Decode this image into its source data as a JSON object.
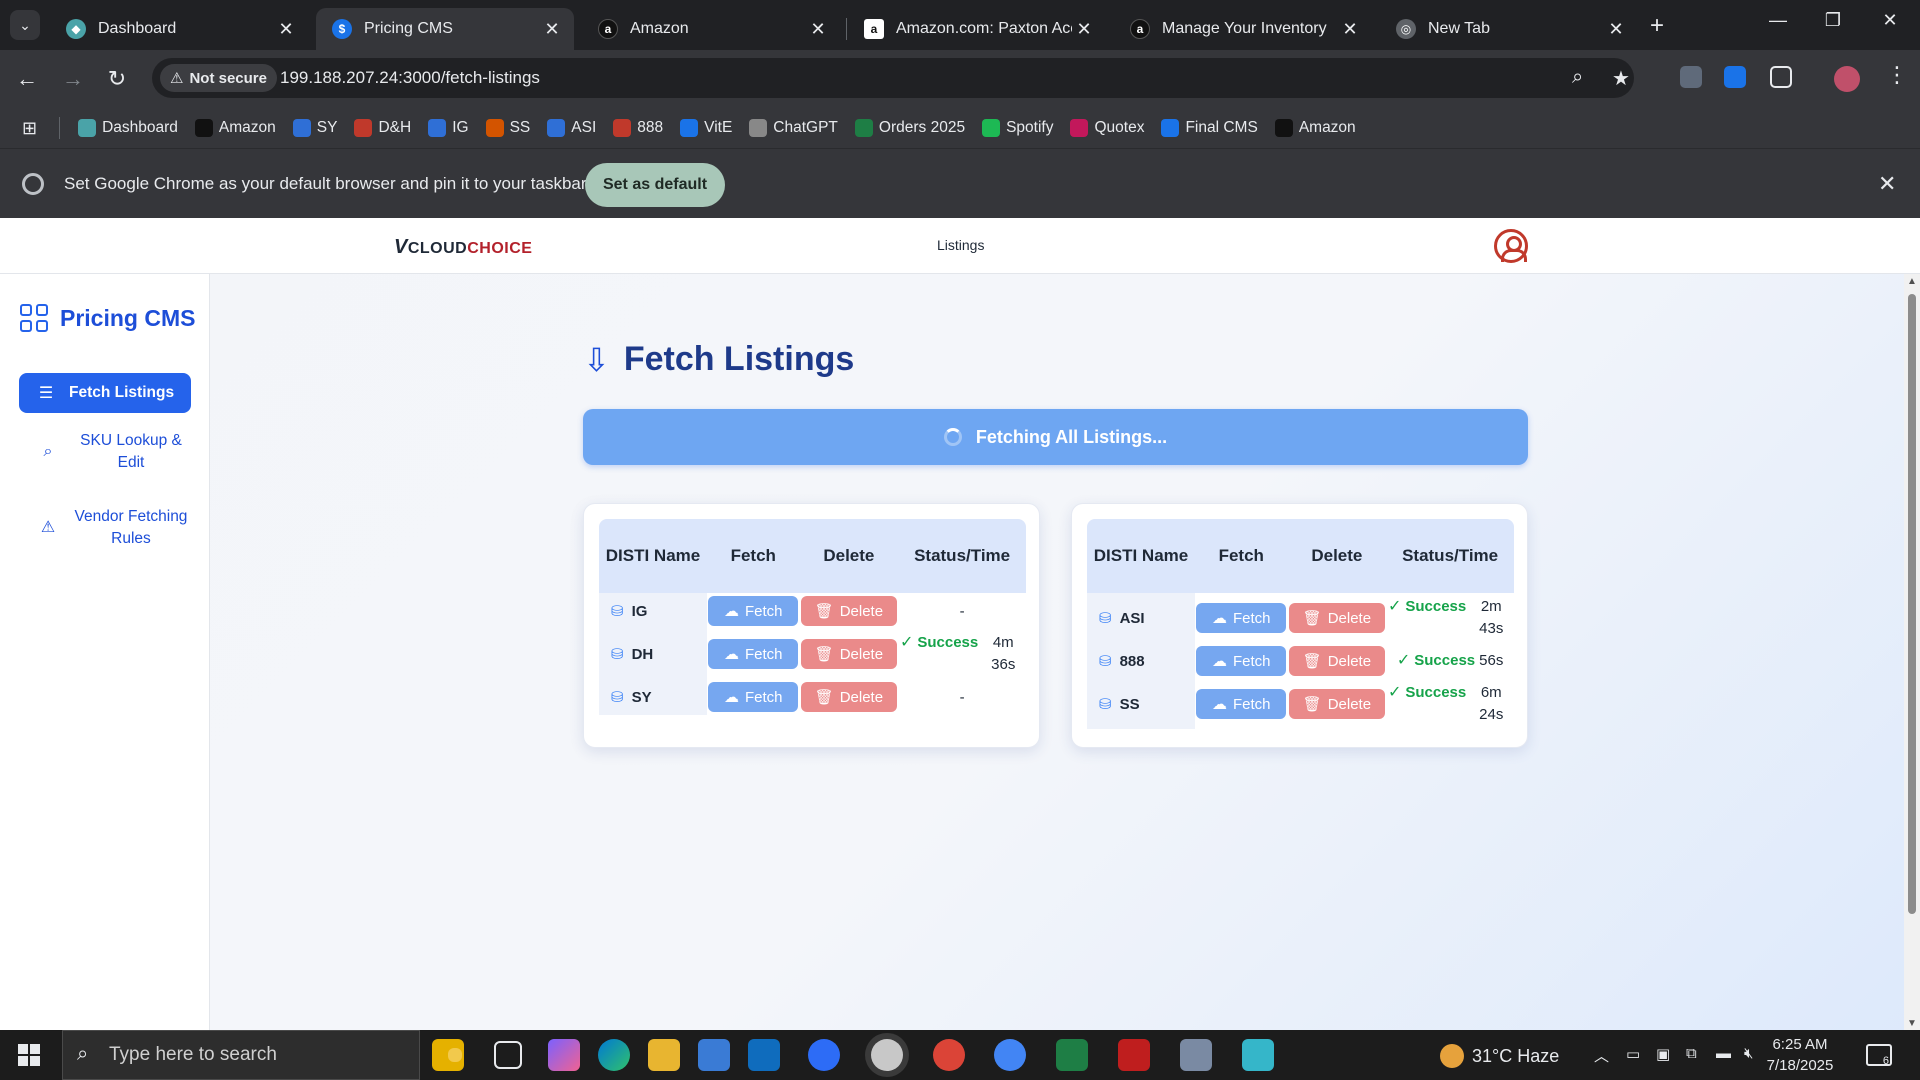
{
  "browser": {
    "tabs": [
      {
        "title": "Dashboard",
        "icon": "dashboard-favicon",
        "active": false
      },
      {
        "title": "Pricing CMS",
        "icon": "dollar-favicon",
        "active": true
      },
      {
        "title": "Amazon",
        "icon": "amazon-favicon",
        "active": false
      },
      {
        "title": "Amazon.com: Paxton Acce",
        "icon": "amazon-favicon",
        "active": false
      },
      {
        "title": "Manage Your Inventory",
        "icon": "amazon-favicon",
        "active": false
      },
      {
        "title": "New Tab",
        "icon": "chrome-favicon",
        "active": false
      }
    ],
    "security_label": "Not secure",
    "url": "199.188.207.24:3000/fetch-listings",
    "bookmarks": [
      {
        "label": "Dashboard",
        "icon": "dashboard-icon",
        "color": "#4aa3a8"
      },
      {
        "label": "Amazon",
        "icon": "amazon-icon",
        "color": "#111111"
      },
      {
        "label": "SY",
        "icon": "ec-icon",
        "color": "#2f6fd6"
      },
      {
        "label": "D&H",
        "icon": "dh-icon",
        "color": "#c0392b"
      },
      {
        "label": "IG",
        "icon": "ig-icon",
        "color": "#2f6fd6"
      },
      {
        "label": "SS",
        "icon": "ss-icon",
        "color": "#d35400"
      },
      {
        "label": "ASI",
        "icon": "asi-icon",
        "color": "#2f6fd6"
      },
      {
        "label": "888",
        "icon": "888-icon",
        "color": "#c0392b"
      },
      {
        "label": "VitE",
        "icon": "dollar-icon",
        "color": "#1a73e8"
      },
      {
        "label": "ChatGPT",
        "icon": "chatgpt-icon",
        "color": "#888888"
      },
      {
        "label": "Orders 2025",
        "icon": "excel-icon",
        "color": "#1e7e45"
      },
      {
        "label": "Spotify",
        "icon": "spotify-icon",
        "color": "#1db954"
      },
      {
        "label": "Quotex",
        "icon": "quotex-icon",
        "color": "#c2185b"
      },
      {
        "label": "Final CMS",
        "icon": "dollar-icon",
        "color": "#1a73e8"
      },
      {
        "label": "Amazon",
        "icon": "amazon-icon",
        "color": "#111111"
      }
    ],
    "infobar_message": "Set Google Chrome as your default browser and pin it to your taskbar",
    "infobar_button": "Set as default"
  },
  "app": {
    "logo_prefix": "V",
    "logo_cloud": "CLOUD",
    "logo_choice": "CHOICE",
    "nav_link": "Listings",
    "brand": "Pricing CMS",
    "sidebar": [
      {
        "label": "Fetch Listings",
        "icon": "list-icon",
        "active": true
      },
      {
        "label": "SKU Lookup & Edit",
        "icon": "search-icon",
        "active": false
      },
      {
        "label": "Vendor Fetching Rules",
        "icon": "warning-icon",
        "active": false
      }
    ],
    "page_title": "Fetch Listings",
    "fetch_all_label": "Fetching All Listings...",
    "table_headers": {
      "name": "DISTI Name",
      "fetch": "Fetch",
      "delete": "Delete",
      "status": "Status/Time"
    },
    "fetch_label": "Fetch",
    "delete_label": "Delete",
    "left_table": [
      {
        "name": "IG",
        "status": "",
        "time": "-"
      },
      {
        "name": "DH",
        "status": "Success",
        "time": "4m 36s"
      },
      {
        "name": "SY",
        "status": "",
        "time": "-"
      }
    ],
    "right_table": [
      {
        "name": "ASI",
        "status": "Success",
        "time": "2m 43s"
      },
      {
        "name": "888",
        "status": "Success",
        "time": "56s"
      },
      {
        "name": "SS",
        "status": "Success",
        "time": "6m 24s"
      }
    ]
  },
  "taskbar": {
    "search_placeholder": "Type here to search",
    "weather": "31°C  Haze",
    "time": "6:25 AM",
    "date": "7/18/2025",
    "notifications": "6"
  }
}
